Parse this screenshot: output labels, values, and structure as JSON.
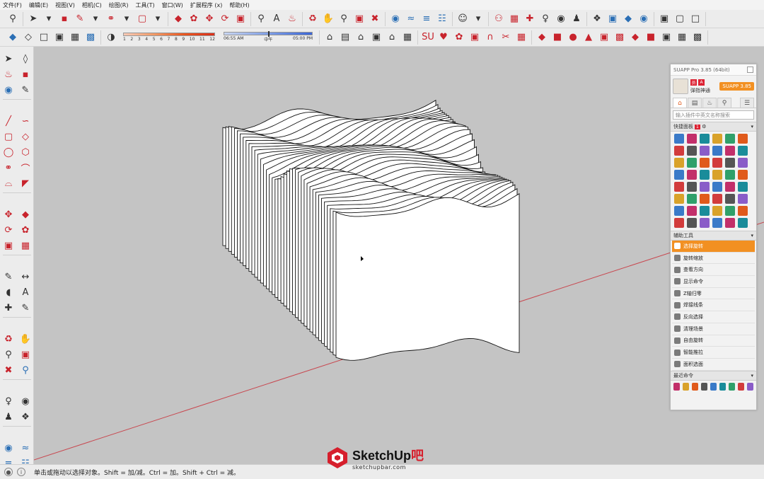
{
  "menu": {
    "items": [
      "文件(F)",
      "编辑(E)",
      "视图(V)",
      "相机(C)",
      "绘图(R)",
      "工具(T)",
      "窗口(W)",
      "扩展程序 (x)",
      "帮助(H)"
    ]
  },
  "shadow": {
    "ticks": [
      "1",
      "2",
      "3",
      "4",
      "5",
      "6",
      "7",
      "8",
      "9",
      "10",
      "11",
      "12"
    ]
  },
  "time": {
    "start": "06:55 AM",
    "mid": "中午",
    "end": "05:00 PM"
  },
  "status": {
    "text": "单击或拖动以选择对象。Shift = 加/减。Ctrl = 加。Shift + Ctrl = 减。"
  },
  "watermark": {
    "title_main": "SketchUp",
    "title_suffix": "吧",
    "url": "sketchupbar.com"
  },
  "suapp": {
    "title": "SUAPP Pro 3.85 (64bit)",
    "version_button": "SUAPP 3.85",
    "user_name": "弹指神通",
    "badge1": "员",
    "badge2": "A",
    "search_placeholder": "输入插件中英文名称搜索",
    "quick_panel_label": "快捷面板",
    "quick_panel_count": "1",
    "aux_tools_label": "辅助工具",
    "recent_label": "最近命令",
    "aux_items": [
      "选择旋转",
      "旋转缩放",
      "查看方向",
      "显示命令",
      "Z轴归零",
      "焊接线条",
      "反向选择",
      "清理场景",
      "自由旋转",
      "智能推拉",
      "面积选面"
    ]
  },
  "colors": {
    "viewport_bg": "#c4c4c4",
    "accent_orange": "#f29022",
    "accent_red": "#d61f2c",
    "axis_red": "#c8474f"
  }
}
